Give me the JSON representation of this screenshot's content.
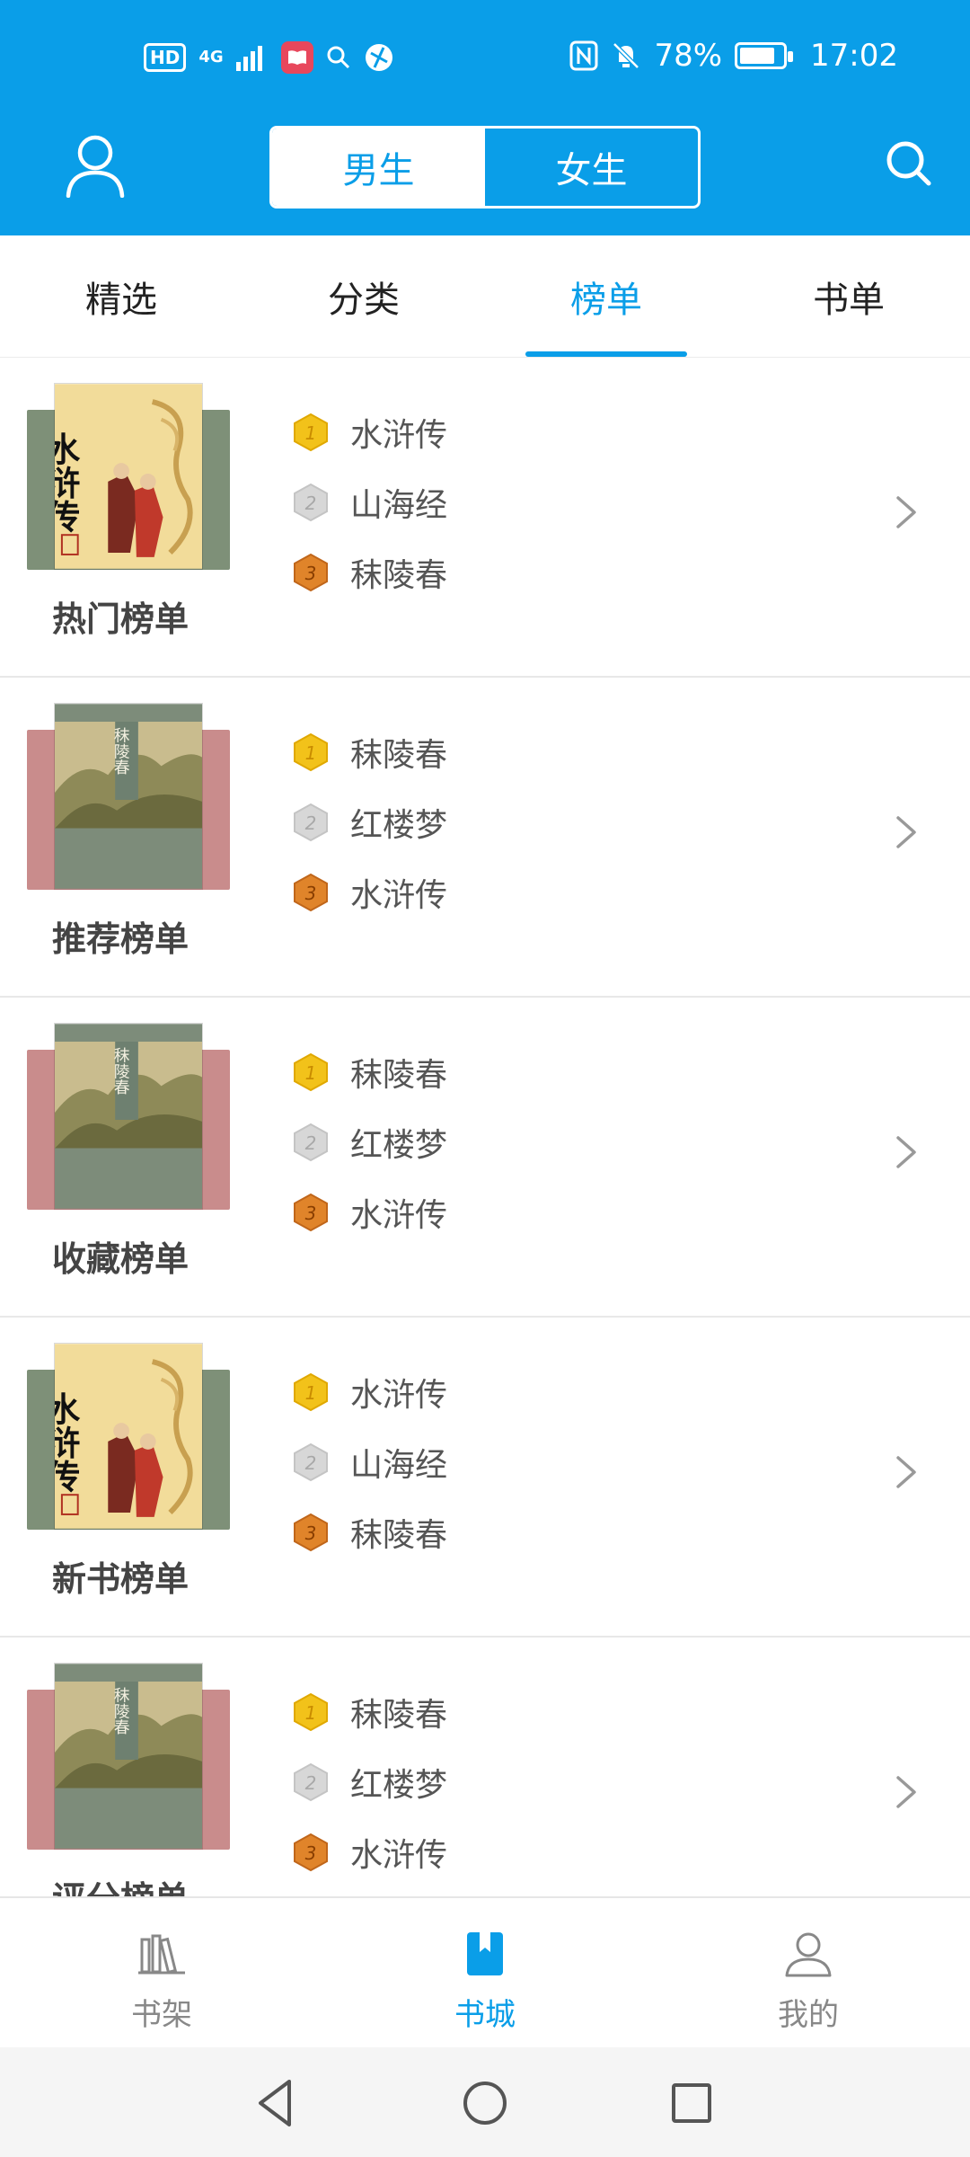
{
  "status_bar": {
    "hd": "HD",
    "network": "4G",
    "battery_pct": "78%",
    "time": "17:02"
  },
  "header": {
    "gender_male": "男生",
    "gender_female": "女生",
    "selected_gender": "男生"
  },
  "tabs": [
    {
      "label": "精选"
    },
    {
      "label": "分类"
    },
    {
      "label": "榜单"
    },
    {
      "label": "书单"
    }
  ],
  "active_tab": "榜单",
  "rankings": [
    {
      "title": "热门榜单",
      "cover": "shuihu",
      "items": [
        "水浒传",
        "山海经",
        "秣陵春"
      ]
    },
    {
      "title": "推荐榜单",
      "cover": "molingchun",
      "items": [
        "秣陵春",
        "红楼梦",
        "水浒传"
      ]
    },
    {
      "title": "收藏榜单",
      "cover": "molingchun",
      "items": [
        "秣陵春",
        "红楼梦",
        "水浒传"
      ]
    },
    {
      "title": "新书榜单",
      "cover": "shuihu",
      "items": [
        "水浒传",
        "山海经",
        "秣陵春"
      ]
    },
    {
      "title": "评分榜单",
      "cover": "molingchun",
      "items": [
        "秣陵春",
        "红楼梦",
        "水浒传"
      ]
    }
  ],
  "medals": [
    "1",
    "2",
    "3"
  ],
  "cover_text": {
    "shuihu": "水浒传",
    "molingchun": "秣陵春"
  },
  "bottom_nav": [
    {
      "label": "书架",
      "icon": "bookshelf-icon"
    },
    {
      "label": "书城",
      "icon": "bookstore-icon"
    },
    {
      "label": "我的",
      "icon": "profile-icon"
    }
  ],
  "active_nav": "书城",
  "colors": {
    "primary": "#0a9ee8",
    "gold": "#f2c21a",
    "silver": "#d7d7d7",
    "bronze": "#e0842a"
  }
}
